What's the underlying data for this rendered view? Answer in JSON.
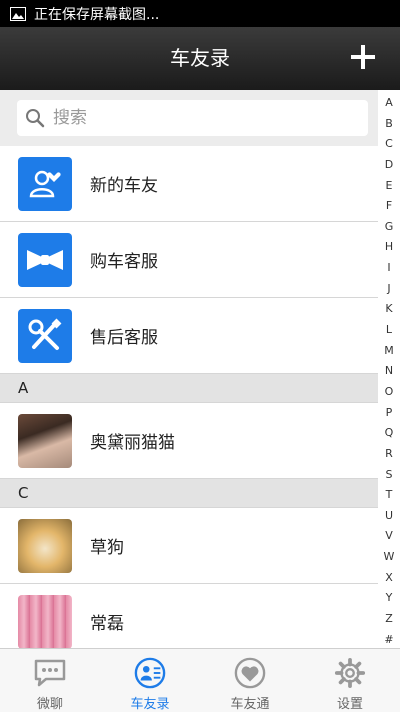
{
  "status_bar": {
    "text": "正在保存屏幕截图..."
  },
  "header": {
    "title": "车友录"
  },
  "search": {
    "placeholder": "搜索"
  },
  "fixed_items": [
    {
      "label": "新的车友",
      "icon": "user-heart-icon"
    },
    {
      "label": "购车客服",
      "icon": "bow-tie-icon"
    },
    {
      "label": "售后客服",
      "icon": "wrench-screwdriver-icon"
    }
  ],
  "sections": [
    {
      "letter": "A",
      "contacts": [
        {
          "name": "奥黛丽猫猫"
        }
      ]
    },
    {
      "letter": "C",
      "contacts": [
        {
          "name": "草狗"
        },
        {
          "name": "常磊"
        }
      ]
    }
  ],
  "index_letters": [
    "A",
    "B",
    "C",
    "D",
    "E",
    "F",
    "G",
    "H",
    "I",
    "J",
    "K",
    "L",
    "M",
    "N",
    "O",
    "P",
    "Q",
    "R",
    "S",
    "T",
    "U",
    "V",
    "W",
    "X",
    "Y",
    "Z",
    "#"
  ],
  "tabs": [
    {
      "label": "微聊",
      "icon": "chat-bubble-icon",
      "active": false
    },
    {
      "label": "车友录",
      "icon": "contacts-icon",
      "active": true
    },
    {
      "label": "车友通",
      "icon": "heart-icon",
      "active": false
    },
    {
      "label": "设置",
      "icon": "gear-icon",
      "active": false
    }
  ],
  "colors": {
    "accent": "#1e7ce8",
    "header_bg": "#2a2a2a",
    "section_bg": "#e3e3e3"
  }
}
